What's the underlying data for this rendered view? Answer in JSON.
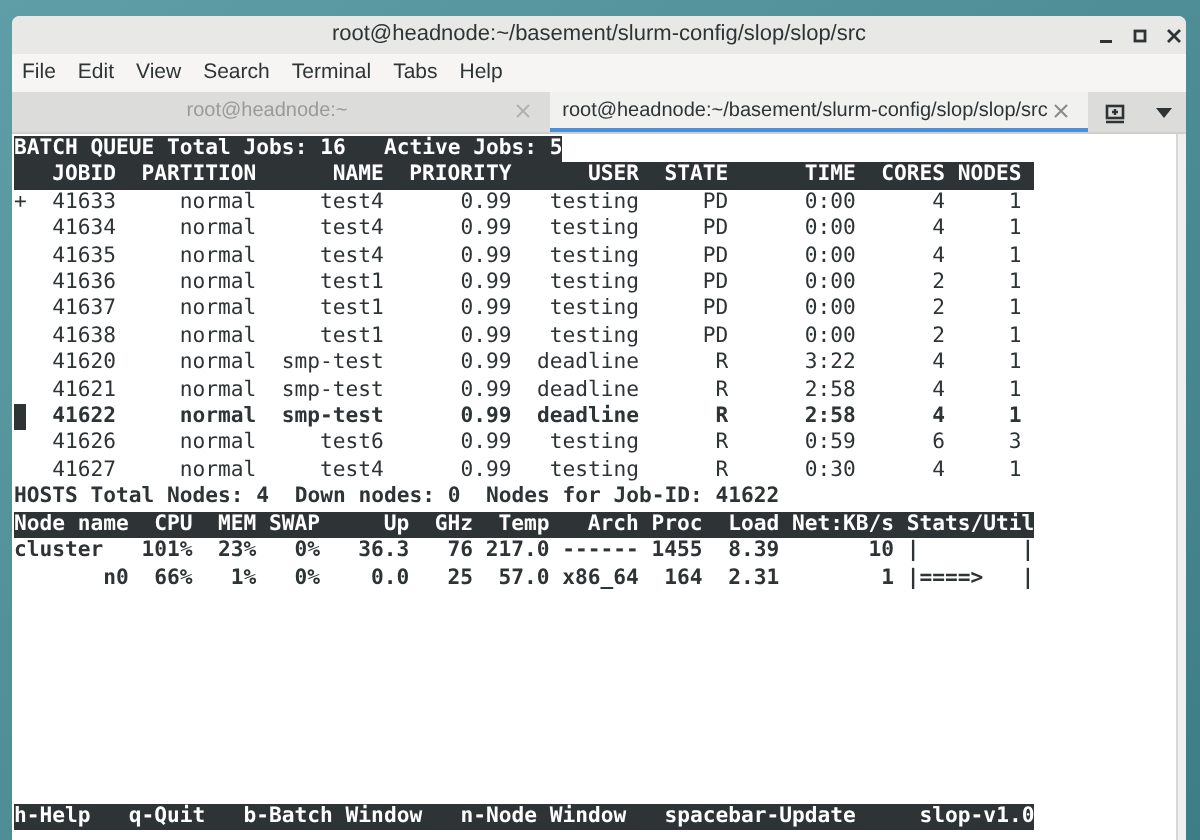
{
  "window": {
    "title": "root@headnode:~/basement/slurm-config/slop/slop/src"
  },
  "menu": [
    "File",
    "Edit",
    "View",
    "Search",
    "Terminal",
    "Tabs",
    "Help"
  ],
  "tabs": [
    {
      "label": "root@headnode:~",
      "selected": false
    },
    {
      "label": "root@headnode:~/basement/slurm-config/slop/slop/src",
      "selected": true
    }
  ],
  "batch_queue": {
    "summary": "BATCH QUEUE Total Jobs: 16   Active Jobs: 5",
    "columns": [
      "JOBID",
      "PARTITION",
      "NAME",
      "PRIORITY",
      "USER",
      "STATE",
      "TIME",
      "CORES",
      "NODES"
    ],
    "rows": [
      {
        "marker": "+",
        "selected": false,
        "cells": [
          "41633",
          "normal",
          "test4",
          "0.99",
          "testing",
          "PD",
          "0:00",
          "4",
          "1"
        ]
      },
      {
        "selected": false,
        "cells": [
          "41634",
          "normal",
          "test4",
          "0.99",
          "testing",
          "PD",
          "0:00",
          "4",
          "1"
        ]
      },
      {
        "selected": false,
        "cells": [
          "41635",
          "normal",
          "test4",
          "0.99",
          "testing",
          "PD",
          "0:00",
          "4",
          "1"
        ]
      },
      {
        "selected": false,
        "cells": [
          "41636",
          "normal",
          "test1",
          "0.99",
          "testing",
          "PD",
          "0:00",
          "2",
          "1"
        ]
      },
      {
        "selected": false,
        "cells": [
          "41637",
          "normal",
          "test1",
          "0.99",
          "testing",
          "PD",
          "0:00",
          "2",
          "1"
        ]
      },
      {
        "selected": false,
        "cells": [
          "41638",
          "normal",
          "test1",
          "0.99",
          "testing",
          "PD",
          "0:00",
          "2",
          "1"
        ]
      },
      {
        "selected": false,
        "cells": [
          "41620",
          "normal",
          "smp-test",
          "0.99",
          "deadline",
          "R",
          "3:22",
          "4",
          "1"
        ]
      },
      {
        "selected": false,
        "cells": [
          "41621",
          "normal",
          "smp-test",
          "0.99",
          "deadline",
          "R",
          "2:58",
          "4",
          "1"
        ]
      },
      {
        "selected": true,
        "cells": [
          "41622",
          "normal",
          "smp-test",
          "0.99",
          "deadline",
          "R",
          "2:58",
          "4",
          "1"
        ]
      },
      {
        "selected": false,
        "cells": [
          "41626",
          "normal",
          "test6",
          "0.99",
          "testing",
          "R",
          "0:59",
          "6",
          "3"
        ]
      },
      {
        "selected": false,
        "cells": [
          "41627",
          "normal",
          "test4",
          "0.99",
          "testing",
          "R",
          "0:30",
          "4",
          "1"
        ]
      }
    ]
  },
  "hosts": {
    "summary": "HOSTS Total Nodes: 4  Down nodes: 0  Nodes for Job-ID: 41622",
    "columns": [
      "Node name",
      "CPU",
      "MEM",
      "SWAP",
      "Up",
      "GHz",
      "Temp",
      "Arch",
      "Proc",
      "Load",
      "Net:KB/s",
      "Stats/Util"
    ],
    "rows": [
      {
        "kind": "cluster",
        "cells": [
          "cluster",
          "101%",
          "23%",
          "0%",
          "36.3",
          "76",
          "217.0",
          "------",
          "1455",
          "8.39",
          "10",
          "|        |"
        ]
      },
      {
        "kind": "node",
        "cells": [
          "n0",
          "66%",
          "1%",
          "0%",
          "0.0",
          "25",
          "57.0",
          "x86_64",
          "164",
          "2.31",
          "1",
          "|====>   |"
        ]
      }
    ]
  },
  "footer": [
    "h-Help",
    "q-Quit",
    "b-Batch Window",
    "n-Node Window",
    "spacebar-Update",
    "slop-v1.0"
  ]
}
